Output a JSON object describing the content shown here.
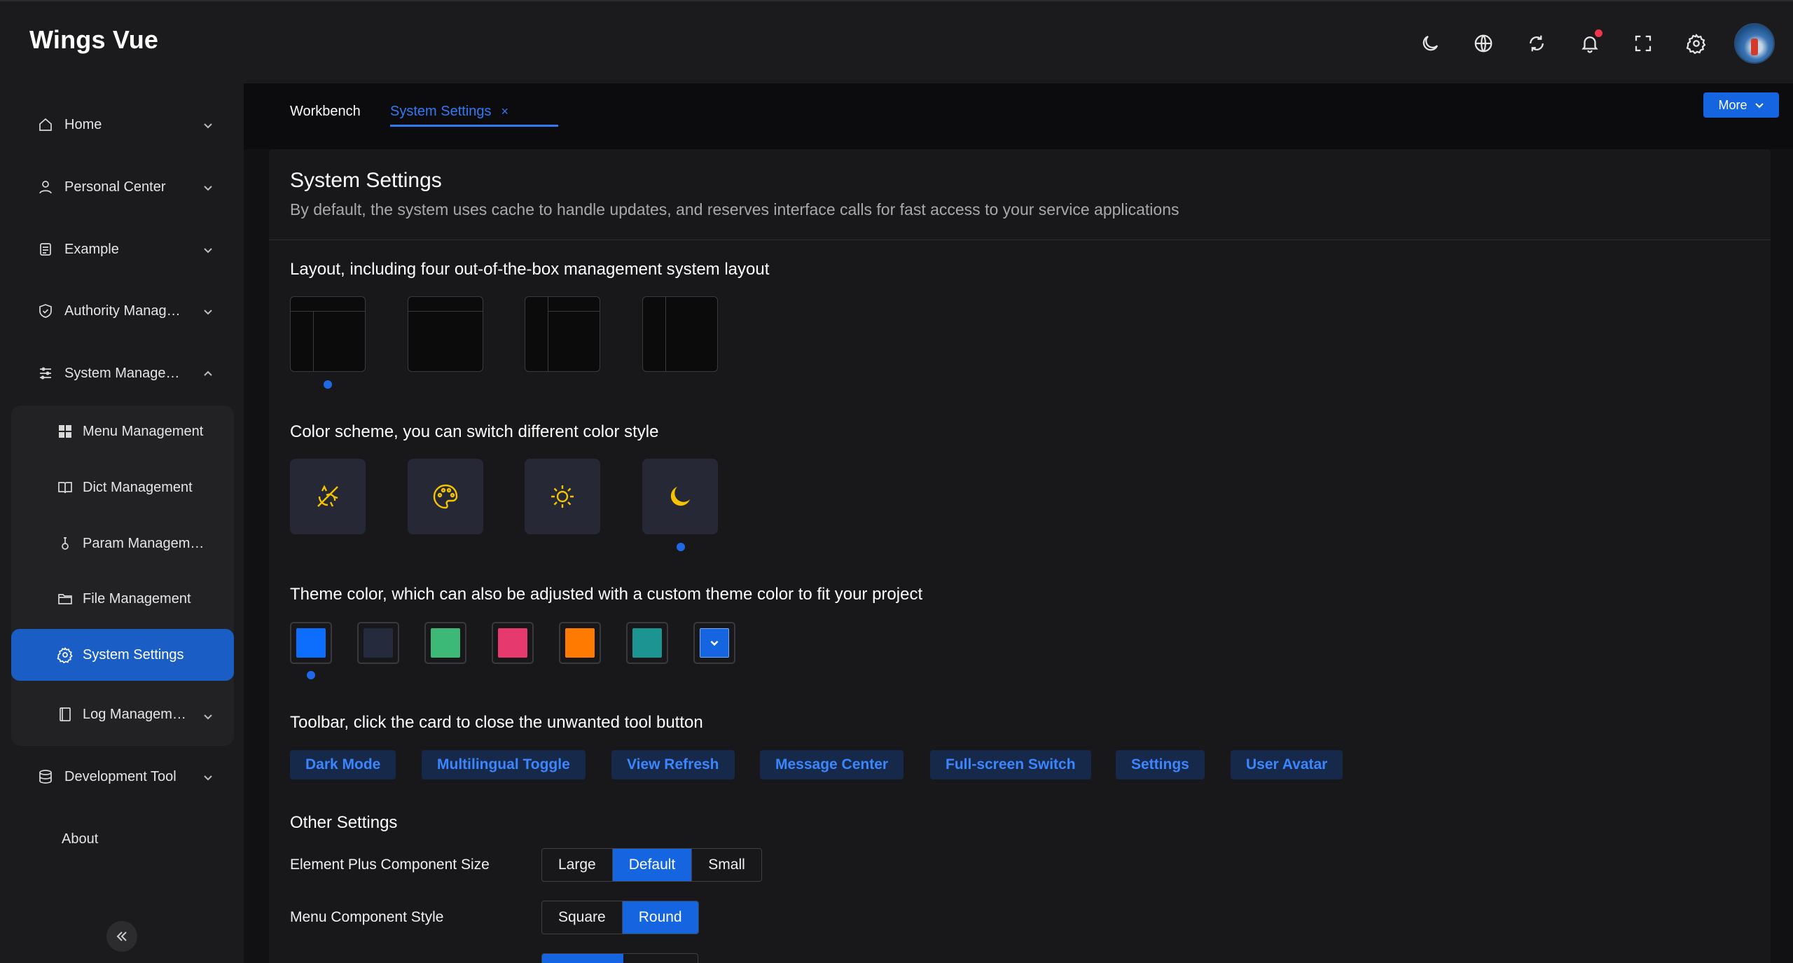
{
  "app": {
    "title": "Wings Vue"
  },
  "header": {
    "tools": [
      {
        "name": "dark-mode",
        "icon": "moon-icon"
      },
      {
        "name": "language",
        "icon": "globe-icon"
      },
      {
        "name": "refresh",
        "icon": "refresh-icon"
      },
      {
        "name": "notifications",
        "icon": "bell-icon",
        "badge": true
      },
      {
        "name": "fullscreen",
        "icon": "fullscreen-icon"
      },
      {
        "name": "settings",
        "icon": "gear-icon"
      }
    ]
  },
  "sidebar": {
    "items": [
      {
        "label": "Home",
        "icon": "home-icon"
      },
      {
        "label": "Personal Center",
        "icon": "user-icon"
      },
      {
        "label": "Example",
        "icon": "example-icon"
      },
      {
        "label": "Authority Manag…",
        "icon": "shield-icon"
      },
      {
        "label": "System Manage…",
        "icon": "sliders-icon",
        "expanded": true
      }
    ],
    "subitems": [
      {
        "label": "Menu Management",
        "icon": "grid-icon"
      },
      {
        "label": "Dict Management",
        "icon": "book-icon"
      },
      {
        "label": "Param Managem…",
        "icon": "param-icon"
      },
      {
        "label": "File Management",
        "icon": "folder-icon"
      },
      {
        "label": "System Settings",
        "icon": "gear-icon",
        "active": true
      },
      {
        "label": "Log Managem…",
        "icon": "log-icon"
      }
    ],
    "bottom_items": [
      {
        "label": "Development Tool",
        "icon": "database-icon"
      },
      {
        "label": "About",
        "icon": ""
      }
    ]
  },
  "tabs": {
    "items": [
      {
        "label": "Workbench"
      },
      {
        "label": "System Settings",
        "active": true,
        "closable": true
      }
    ],
    "close_glyph": "×",
    "more_label": "More"
  },
  "main": {
    "title": "System Settings",
    "description": "By default, the system uses cache to handle updates, and reserves interface calls for fast access to your service applications",
    "layout_section": {
      "title": "Layout, including four out-of-the-box management system layout",
      "selected_index": 0
    },
    "color_scheme_section": {
      "title": "Color scheme, you can switch different color style",
      "options": [
        "auto-icon",
        "palette-icon",
        "sun-icon",
        "moon-icon"
      ],
      "selected_index": 3
    },
    "theme_color_section": {
      "title": "Theme color, which can also be adjusted with a custom theme color to fit your project",
      "colors": [
        "#0d6efd",
        "#262a3d",
        "#3cb877",
        "#e6396e",
        "#ff7a00",
        "#1c9491",
        "#1565e0"
      ],
      "selected_index": 0
    },
    "toolbar_section": {
      "title": "Toolbar, click the card to close the unwanted tool button",
      "chips": [
        "Dark Mode",
        "Multilingual Toggle",
        "View Refresh",
        "Message Center",
        "Full-screen Switch",
        "Settings",
        "User Avatar"
      ]
    },
    "other_settings": {
      "title": "Other Settings",
      "size_label": "Element Plus Component Size",
      "size_options": [
        "Large",
        "Default",
        "Small"
      ],
      "size_selected": "Default",
      "menu_style_label": "Menu Component Style",
      "menu_style_options": [
        "Square",
        "Round"
      ],
      "menu_style_selected": "Round"
    }
  }
}
